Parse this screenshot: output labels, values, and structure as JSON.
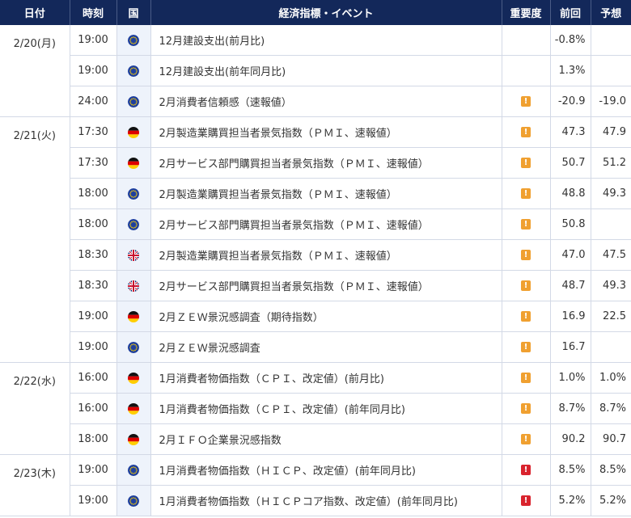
{
  "headers": {
    "date": "日付",
    "time": "時刻",
    "country": "国",
    "event": "経済指標・イベント",
    "importance": "重要度",
    "previous": "前回",
    "forecast": "予想"
  },
  "colors": {
    "header_bg": "#13285a",
    "importance_mid": "#f0a030",
    "importance_high": "#d9232d",
    "flag_column_bg": "#eef3fb"
  },
  "rows": [
    {
      "date": "2/20(月)",
      "time": "19:00",
      "country": "eu-flag-icon",
      "event": "12月建設支出(前月比)",
      "importance": "",
      "previous": "-0.8%",
      "forecast": ""
    },
    {
      "date": "",
      "time": "19:00",
      "country": "eu-flag-icon",
      "event": "12月建設支出(前年同月比)",
      "importance": "",
      "previous": "1.3%",
      "forecast": ""
    },
    {
      "date": "",
      "time": "24:00",
      "country": "eu-flag-icon",
      "event": "2月消費者信頼感（速報値）",
      "importance": "mid",
      "previous": "-20.9",
      "forecast": "-19.0"
    },
    {
      "date": "2/21(火)",
      "time": "17:30",
      "country": "de-flag-icon",
      "event": "2月製造業購買担当者景気指数（ＰＭＩ、速報値）",
      "importance": "mid",
      "previous": "47.3",
      "forecast": "47.9"
    },
    {
      "date": "",
      "time": "17:30",
      "country": "de-flag-icon",
      "event": "2月サービス部門購買担当者景気指数（ＰＭＩ、速報値）",
      "importance": "mid",
      "previous": "50.7",
      "forecast": "51.2"
    },
    {
      "date": "",
      "time": "18:00",
      "country": "eu-flag-icon",
      "event": "2月製造業購買担当者景気指数（ＰＭＩ、速報値）",
      "importance": "mid",
      "previous": "48.8",
      "forecast": "49.3"
    },
    {
      "date": "",
      "time": "18:00",
      "country": "eu-flag-icon",
      "event": "2月サービス部門購買担当者景気指数（ＰＭＩ、速報値）",
      "importance": "mid",
      "previous": "50.8",
      "forecast": ""
    },
    {
      "date": "",
      "time": "18:30",
      "country": "uk-flag-icon",
      "event": "2月製造業購買担当者景気指数（ＰＭＩ、速報値）",
      "importance": "mid",
      "previous": "47.0",
      "forecast": "47.5"
    },
    {
      "date": "",
      "time": "18:30",
      "country": "uk-flag-icon",
      "event": "2月サービス部門購買担当者景気指数（ＰＭＩ、速報値）",
      "importance": "mid",
      "previous": "48.7",
      "forecast": "49.3"
    },
    {
      "date": "",
      "time": "19:00",
      "country": "de-flag-icon",
      "event": "2月ＺＥＷ景況感調査（期待指数）",
      "importance": "mid",
      "previous": "16.9",
      "forecast": "22.5"
    },
    {
      "date": "",
      "time": "19:00",
      "country": "eu-flag-icon",
      "event": "2月ＺＥＷ景況感調査",
      "importance": "mid",
      "previous": "16.7",
      "forecast": ""
    },
    {
      "date": "2/22(水)",
      "time": "16:00",
      "country": "de-flag-icon",
      "event": "1月消費者物価指数（ＣＰＩ、改定値）(前月比)",
      "importance": "mid",
      "previous": "1.0%",
      "forecast": "1.0%"
    },
    {
      "date": "",
      "time": "16:00",
      "country": "de-flag-icon",
      "event": "1月消費者物価指数（ＣＰＩ、改定値）(前年同月比)",
      "importance": "mid",
      "previous": "8.7%",
      "forecast": "8.7%"
    },
    {
      "date": "",
      "time": "18:00",
      "country": "de-flag-icon",
      "event": "2月ＩＦＯ企業景況感指数",
      "importance": "mid",
      "previous": "90.2",
      "forecast": "90.7"
    },
    {
      "date": "2/23(木)",
      "time": "19:00",
      "country": "eu-flag-icon",
      "event": "1月消費者物価指数（ＨＩＣＰ、改定値）(前年同月比)",
      "importance": "high",
      "previous": "8.5%",
      "forecast": "8.5%"
    },
    {
      "date": "",
      "time": "19:00",
      "country": "eu-flag-icon",
      "event": "1月消費者物価指数（ＨＩＣＰコア指数、改定値）(前年同月比)",
      "importance": "high",
      "previous": "5.2%",
      "forecast": "5.2%"
    }
  ],
  "date_groups": [
    {
      "label": "2/20(月)",
      "span": 3
    },
    {
      "label": "2/21(火)",
      "span": 8
    },
    {
      "label": "2/22(水)",
      "span": 3
    },
    {
      "label": "2/23(木)",
      "span": 2
    }
  ]
}
